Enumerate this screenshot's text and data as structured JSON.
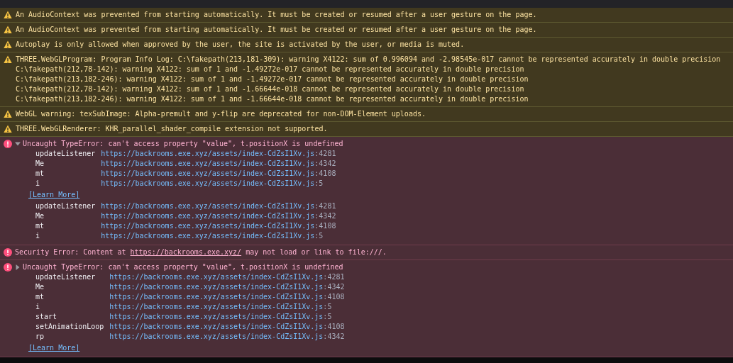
{
  "messages": [
    {
      "kind": "warning",
      "lines": [
        "An AudioContext was prevented from starting automatically. It must be created or resumed after a user gesture on the page."
      ]
    },
    {
      "kind": "warning",
      "lines": [
        "An AudioContext was prevented from starting automatically. It must be created or resumed after a user gesture on the page."
      ]
    },
    {
      "kind": "warning",
      "lines": [
        "Autoplay is only allowed when approved by the user, the site is activated by the user, or media is muted."
      ]
    },
    {
      "kind": "warning",
      "lines": [
        "THREE.WebGLProgram: Program Info Log: C:\\fakepath(213,181-309): warning X4122: sum of 0.996094 and -2.98545e-017 cannot be represented accurately in double precision",
        "C:\\fakepath(212,78-142): warning X4122: sum of 1 and -1.49272e-017 cannot be represented accurately in double precision",
        "C:\\fakepath(213,182-246): warning X4122: sum of 1 and -1.49272e-017 cannot be represented accurately in double precision",
        "C:\\fakepath(212,78-142): warning X4122: sum of 1 and -1.66644e-018 cannot be represented accurately in double precision",
        "C:\\fakepath(213,182-246): warning X4122: sum of 1 and -1.66644e-018 cannot be represented accurately in double precision"
      ]
    },
    {
      "kind": "warning",
      "lines": [
        "WebGL warning: texSubImage: Alpha-premult and y-flip are deprecated for non-DOM-Element uploads."
      ]
    },
    {
      "kind": "warning",
      "lines": [
        "THREE.WebGLRenderer: KHR_parallel_shader_compile extension not supported."
      ]
    },
    {
      "kind": "error",
      "expanded": true,
      "text": "Uncaught TypeError: can't access property \"value\", t.positionX is undefined",
      "blocks": [
        {
          "kind": "stack",
          "frames": [
            {
              "fn": "updateListener",
              "url": "https://backrooms.exe.xyz/assets/index-CdZsI1Xv.js",
              "line": ":4281"
            },
            {
              "fn": "Me",
              "url": "https://backrooms.exe.xyz/assets/index-CdZsI1Xv.js",
              "line": ":4342"
            },
            {
              "fn": "mt",
              "url": "https://backrooms.exe.xyz/assets/index-CdZsI1Xv.js",
              "line": ":4108"
            },
            {
              "fn": "i",
              "url": "https://backrooms.exe.xyz/assets/index-CdZsI1Xv.js",
              "line": ":5"
            }
          ]
        },
        {
          "kind": "learn_more",
          "label": "[Learn More]"
        },
        {
          "kind": "stack",
          "frames": [
            {
              "fn": "updateListener",
              "url": "https://backrooms.exe.xyz/assets/index-CdZsI1Xv.js",
              "line": ":4281"
            },
            {
              "fn": "Me",
              "url": "https://backrooms.exe.xyz/assets/index-CdZsI1Xv.js",
              "line": ":4342"
            },
            {
              "fn": "mt",
              "url": "https://backrooms.exe.xyz/assets/index-CdZsI1Xv.js",
              "line": ":4108"
            },
            {
              "fn": "i",
              "url": "https://backrooms.exe.xyz/assets/index-CdZsI1Xv.js",
              "line": ":5"
            }
          ]
        }
      ]
    },
    {
      "kind": "error",
      "text": "Security Error: Content at ",
      "link": "https://backrooms.exe.xyz/",
      "after": " may not load or link to file:///."
    },
    {
      "kind": "error",
      "expanded": false,
      "text": "Uncaught TypeError: can't access property \"value\", t.positionX is undefined",
      "blocks": [
        {
          "kind": "stack",
          "frames": [
            {
              "fn": "updateListener",
              "url": "https://backrooms.exe.xyz/assets/index-CdZsI1Xv.js",
              "line": ":4281"
            },
            {
              "fn": "Me",
              "url": "https://backrooms.exe.xyz/assets/index-CdZsI1Xv.js",
              "line": ":4342"
            },
            {
              "fn": "mt",
              "url": "https://backrooms.exe.xyz/assets/index-CdZsI1Xv.js",
              "line": ":4108"
            },
            {
              "fn": "i",
              "url": "https://backrooms.exe.xyz/assets/index-CdZsI1Xv.js",
              "line": ":5"
            },
            {
              "fn": "start",
              "url": "https://backrooms.exe.xyz/assets/index-CdZsI1Xv.js",
              "line": ":5"
            },
            {
              "fn": "setAnimationLoop",
              "url": "https://backrooms.exe.xyz/assets/index-CdZsI1Xv.js",
              "line": ":4108"
            },
            {
              "fn": "rp",
              "url": "https://backrooms.exe.xyz/assets/index-CdZsI1Xv.js",
              "line": ":4342"
            }
          ]
        },
        {
          "kind": "learn_more",
          "label": "[Learn More]"
        }
      ]
    }
  ]
}
